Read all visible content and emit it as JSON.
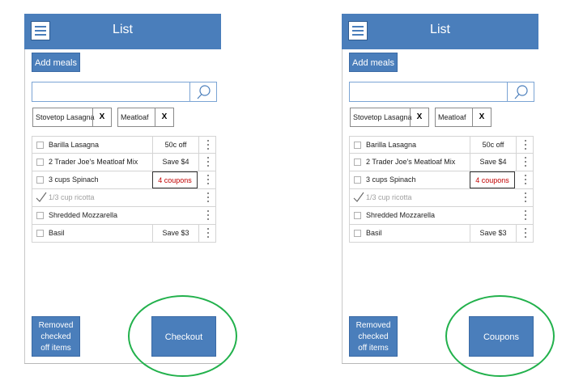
{
  "screens": [
    {
      "title": "List",
      "add_meals_label": "Add meals",
      "search_placeholder": "",
      "chips": [
        {
          "label": "Stovetop Lasagna",
          "remove": "X"
        },
        {
          "label": "Meatloaf",
          "remove": "X"
        }
      ],
      "items": [
        {
          "name": "Barilla Lasagna",
          "deal": "50c off",
          "checked": false
        },
        {
          "name": "2 Trader Joe's Meatloaf Mix",
          "deal": "Save $4",
          "checked": false
        },
        {
          "name": "3 cups Spinach",
          "deal": "4 coupons",
          "checked": false
        },
        {
          "name": "1/3 cup ricotta",
          "deal": "",
          "checked": true
        },
        {
          "name": "Shredded Mozzarella",
          "deal": "",
          "checked": false
        },
        {
          "name": "Basil",
          "deal": "Save $3",
          "checked": false
        }
      ],
      "removed_label_lines": [
        "Removed",
        "checked",
        "off items"
      ],
      "action_label": "Checkout"
    },
    {
      "title": "List",
      "add_meals_label": "Add meals",
      "search_placeholder": "",
      "chips": [
        {
          "label": "Stovetop Lasagna",
          "remove": "X"
        },
        {
          "label": "Meatloaf",
          "remove": "X"
        }
      ],
      "items": [
        {
          "name": "Barilla Lasagna",
          "deal": "50c off",
          "checked": false
        },
        {
          "name": "2 Trader Joe's Meatloaf Mix",
          "deal": "Save $4",
          "checked": false
        },
        {
          "name": "3 cups Spinach",
          "deal": "4 coupons",
          "checked": false
        },
        {
          "name": "1/3 cup ricotta",
          "deal": "",
          "checked": true
        },
        {
          "name": "Shredded Mozzarella",
          "deal": "",
          "checked": false
        },
        {
          "name": "Basil",
          "deal": "Save $3",
          "checked": false
        }
      ],
      "removed_label_lines": [
        "Removed",
        "checked",
        "off items"
      ],
      "action_label": "Coupons"
    }
  ],
  "colors": {
    "primary": "#4a7ebb",
    "coupon_text": "#c00000",
    "highlight_circle": "#22b14c"
  },
  "icons": {
    "menu": "hamburger-icon",
    "search": "search-icon",
    "remove": "close-icon",
    "row_menu": "more-vertical-icon",
    "check": "checkmark-icon"
  }
}
